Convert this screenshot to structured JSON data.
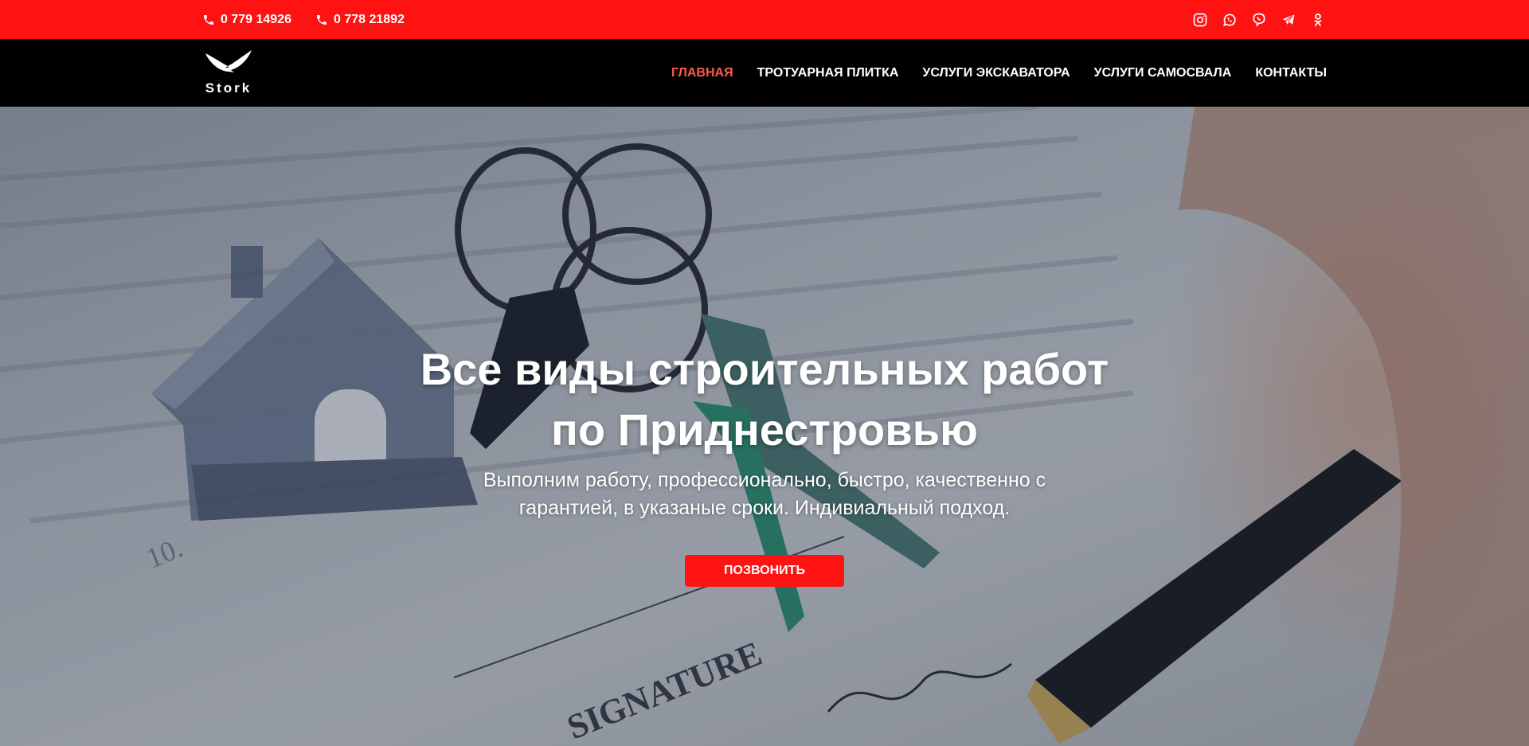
{
  "topbar": {
    "background": "#ff1212",
    "phones": [
      {
        "icon": "phone-icon",
        "number": "0 779 14926"
      },
      {
        "icon": "phone-icon",
        "number": "0 778 21892"
      }
    ],
    "social": [
      "instagram-icon",
      "whatsapp-icon",
      "viber-icon",
      "telegram-icon",
      "odnoklassniki-icon"
    ]
  },
  "header": {
    "logo": {
      "text": "Stork",
      "icon": "stork-bird-icon"
    },
    "nav": [
      {
        "label": "ГЛАВНАЯ",
        "active": true
      },
      {
        "label": "ТРОТУАРНАЯ ПЛИТКА",
        "active": false
      },
      {
        "label": "УСЛУГИ ЭКСКАВАТОРА",
        "active": false
      },
      {
        "label": "УСЛУГИ САМОСВАЛА",
        "active": false
      },
      {
        "label": "КОНТАКТЫ",
        "active": false
      }
    ],
    "active_color": "#ff5a4a"
  },
  "hero": {
    "title_line1": "Все виды строительных работ",
    "title_line2": "по Приднестровью",
    "subtitle_line1": "Выполним работу, профессионально, быстро, качественно с",
    "subtitle_line2": "гарантией, в указаные сроки. Индивиальный подход.",
    "cta_label": "ПОЗВОНИТЬ",
    "cta_color": "#ff1212"
  }
}
